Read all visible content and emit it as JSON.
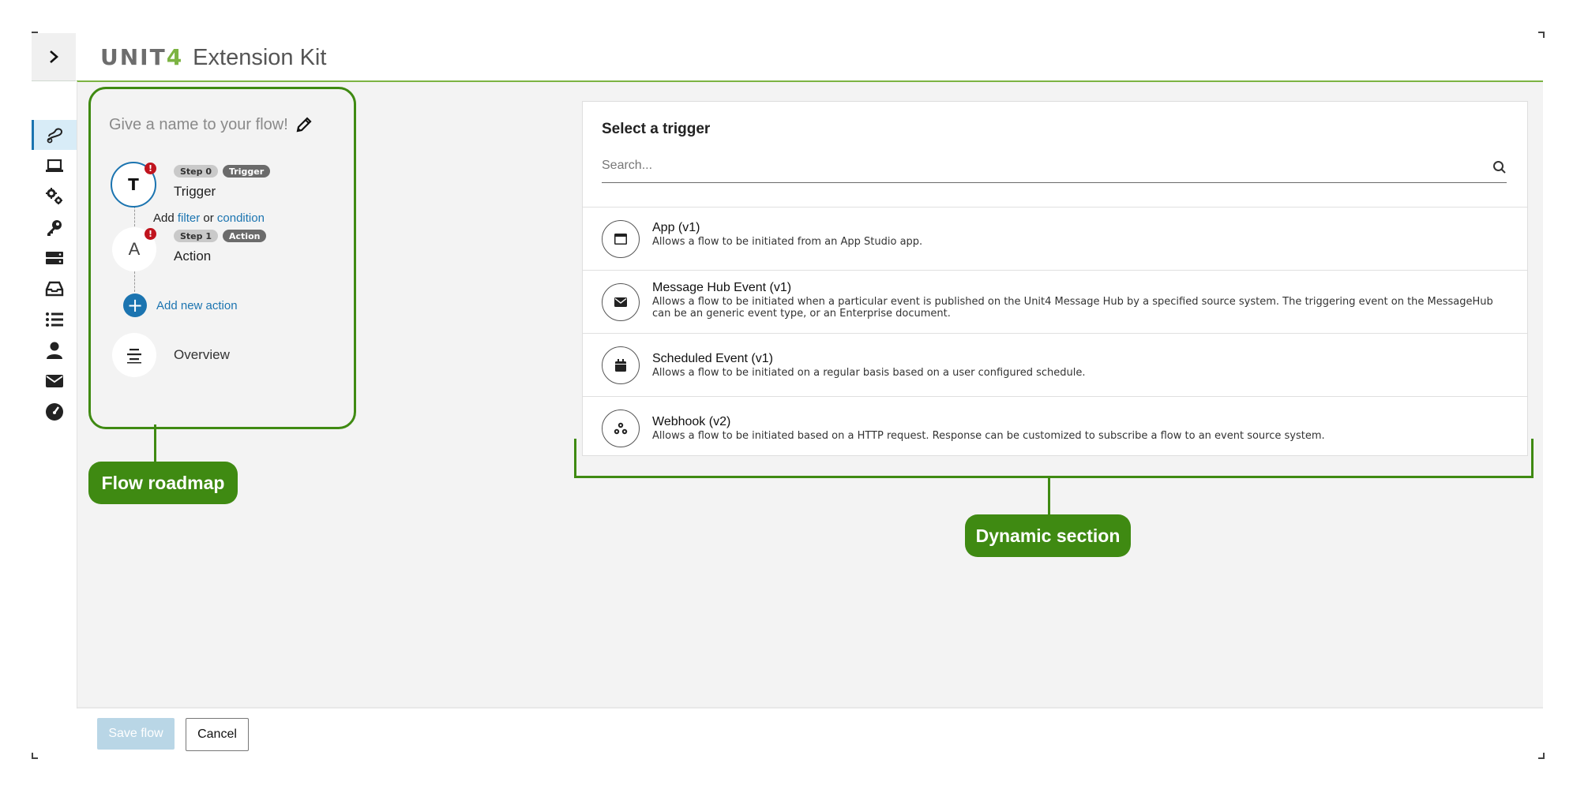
{
  "header": {
    "logo_text": "UNIT",
    "logo_number": "4",
    "app_title": "Extension Kit"
  },
  "sidebar": {
    "toggle_icon": "chevron-right-icon",
    "items": [
      {
        "icon": "flow-icon",
        "active": true
      },
      {
        "icon": "laptop-icon"
      },
      {
        "icon": "gears-icon"
      },
      {
        "icon": "key-icon"
      },
      {
        "icon": "server-icon"
      },
      {
        "icon": "inbox-icon"
      },
      {
        "icon": "list-icon"
      },
      {
        "icon": "user-icon"
      },
      {
        "icon": "envelope-icon"
      },
      {
        "icon": "dashboard-icon"
      }
    ]
  },
  "roadmap": {
    "flow_name_placeholder": "Give a name to your flow!",
    "trigger": {
      "letter": "T",
      "step": "Step 0",
      "kind": "Trigger",
      "label": "Trigger"
    },
    "add_text": "Add",
    "filter_link": "filter",
    "or_text": "or",
    "condition_link": "condition",
    "action": {
      "letter": "A",
      "step": "Step 1",
      "kind": "Action",
      "label": "Action"
    },
    "add_action_label": "Add new action",
    "overview_label": "Overview",
    "error_badge": "!"
  },
  "callouts": {
    "roadmap": "Flow roadmap",
    "dynamic": "Dynamic section"
  },
  "trigger_panel": {
    "title": "Select a trigger",
    "search_placeholder": "Search...",
    "items": [
      {
        "name": "App (v1)",
        "description": "Allows a flow to be initiated from an App Studio app.",
        "icon": "app-window-icon"
      },
      {
        "name": "Message Hub Event (v1)",
        "description": "Allows a flow to be initiated when a particular event is published on the Unit4 Message Hub by a specified source system. The triggering event on the MessageHub can be an generic event type, or an Enterprise document.",
        "icon": "envelope-icon"
      },
      {
        "name": "Scheduled Event (v1)",
        "description": "Allows a flow to be initiated on a regular basis based on a user configured schedule.",
        "icon": "calendar-icon"
      },
      {
        "name": "Webhook (v2)",
        "description": "Allows a flow to be initiated based on a HTTP request. Response can be customized to subscribe a flow to an event source system.",
        "icon": "webhook-icon"
      }
    ]
  },
  "footer": {
    "save_label": "Save flow",
    "cancel_label": "Cancel"
  },
  "colors": {
    "accent": "#1b74b0",
    "brand_green": "#7cb342",
    "callout_green": "#3f8a12",
    "error": "#c0141e"
  }
}
